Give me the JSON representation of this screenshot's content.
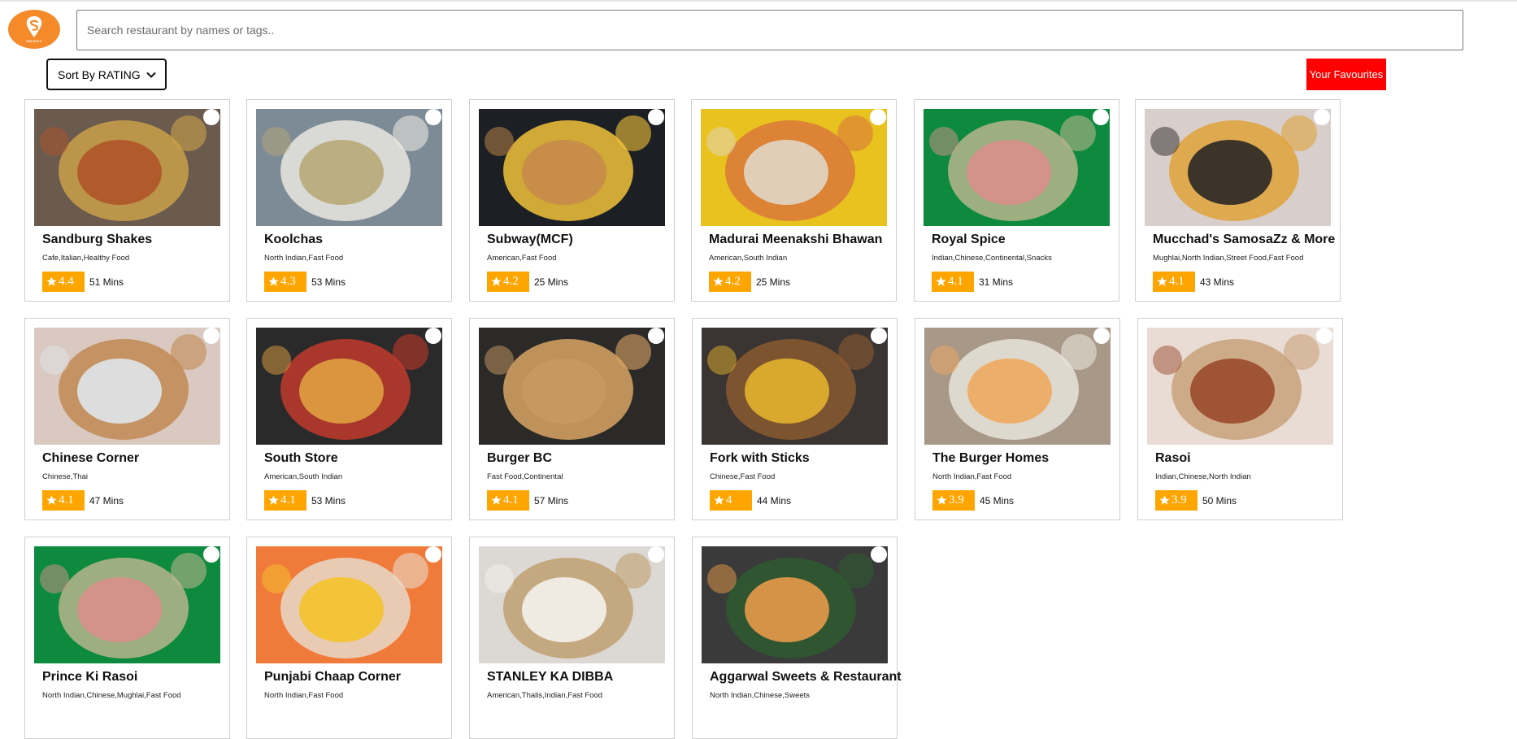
{
  "brand": {
    "name": "SWIGGY",
    "color": "#f58a2a"
  },
  "search": {
    "placeholder": "Search restaurant by names or tags..",
    "value": ""
  },
  "sort": {
    "selected": "Sort By RATING"
  },
  "favourites_button": {
    "label": "Your Favourites",
    "color": "#ff0000"
  },
  "rating_color": "#ffa500",
  "restaurants": [
    {
      "name": "Sandburg Shakes",
      "tags": "Cafe,Italian,Healthy Food",
      "rating": "4.4",
      "time": "51 Mins",
      "image": "biryani-chicken",
      "palette": [
        "#6b5a4e",
        "#b0542a",
        "#c9a14a"
      ]
    },
    {
      "name": "Koolchas",
      "tags": "North Indian,Fast Food",
      "rating": "4.3",
      "time": "53 Mins",
      "image": "parathas",
      "palette": [
        "#7d8b97",
        "#b7a878",
        "#e9e6df"
      ]
    },
    {
      "name": "Subway(MCF)",
      "tags": "American,Fast Food",
      "rating": "4.2",
      "time": "25 Mins",
      "image": "burger-fries",
      "palette": [
        "#1c2024",
        "#c7894a",
        "#f0c23a"
      ]
    },
    {
      "name": "Madurai Meenakshi Bhawan",
      "tags": "American,South Indian",
      "rating": "4.2",
      "time": "25 Mins",
      "image": "thali-plate",
      "palette": [
        "#e8c21e",
        "#e0d6c6",
        "#d9783a"
      ]
    },
    {
      "name": "Royal Spice",
      "tags": "Indian,Chinese,Continental,Snacks",
      "rating": "4.1",
      "time": "31 Mins",
      "image": "wraps",
      "palette": [
        "#0d8a3e",
        "#d9908c",
        "#b7b48c"
      ]
    },
    {
      "name": "Mucchad's SamosaZz & More",
      "tags": "Mughlai,North Indian,Street Food,Fast Food",
      "rating": "4.1",
      "time": "43 Mins",
      "image": "noodles",
      "palette": [
        "#d8cfcc",
        "#2b2725",
        "#e0a23a"
      ]
    },
    {
      "name": "Chinese Corner",
      "tags": "Chinese,Thai",
      "rating": "4.1",
      "time": "47 Mins",
      "image": "dosa",
      "palette": [
        "#d9c9c0",
        "#dfe6ea",
        "#c18a52"
      ]
    },
    {
      "name": "South Store",
      "tags": "American,South Indian",
      "rating": "4.1",
      "time": "53 Mins",
      "image": "pizza",
      "palette": [
        "#2a2a2a",
        "#e0a040",
        "#c0392b"
      ]
    },
    {
      "name": "Burger BC",
      "tags": "Fast Food,Continental",
      "rating": "4.1",
      "time": "57 Mins",
      "image": "burger-king",
      "palette": [
        "#2c2a28",
        "#c79a64",
        "#d9a464"
      ]
    },
    {
      "name": "Fork with Sticks",
      "tags": "Chinese,Fast Food",
      "rating": "4",
      "time": "44 Mins",
      "image": "biryani-plate",
      "palette": [
        "#3a3432",
        "#e2b22e",
        "#8a5a30"
      ]
    },
    {
      "name": "The Burger Homes",
      "tags": "North Indian,Fast Food",
      "rating": "3.9",
      "time": "45 Mins",
      "image": "dosa-chutney",
      "palette": [
        "#a89888",
        "#f0a860",
        "#e8e4da"
      ]
    },
    {
      "name": "Rasoi",
      "tags": "Indian,Chinese,North Indian",
      "rating": "3.9",
      "time": "50 Mins",
      "image": "tandoori-platter",
      "palette": [
        "#e9dcd4",
        "#9a4a2e",
        "#c9a27a"
      ]
    },
    {
      "name": "Prince Ki Rasoi",
      "tags": "North Indian,Chinese,Mughlai,Fast Food",
      "rating": "",
      "time": "",
      "image": "wraps",
      "palette": [
        "#0d8a3e",
        "#d9908c",
        "#b7b48c"
      ]
    },
    {
      "name": "Punjabi Chaap Corner",
      "tags": "North Indian,Fast Food",
      "rating": "",
      "time": "",
      "image": "thali-orange",
      "palette": [
        "#f07a3a",
        "#f4c22a",
        "#e8d8c8"
      ]
    },
    {
      "name": "STANLEY KA DIBBA",
      "tags": "American,Thalis,Indian,Fast Food",
      "rating": "",
      "time": "",
      "image": "momos-noodles",
      "palette": [
        "#dcd8d4",
        "#f4f2ee",
        "#c0a070"
      ]
    },
    {
      "name": "Aggarwal Sweets & Restaurant",
      "tags": "North Indian,Chinese,Sweets",
      "rating": "",
      "time": "",
      "image": "bhature",
      "palette": [
        "#3a3a3a",
        "#e89a4a",
        "#2f5a30"
      ]
    }
  ]
}
